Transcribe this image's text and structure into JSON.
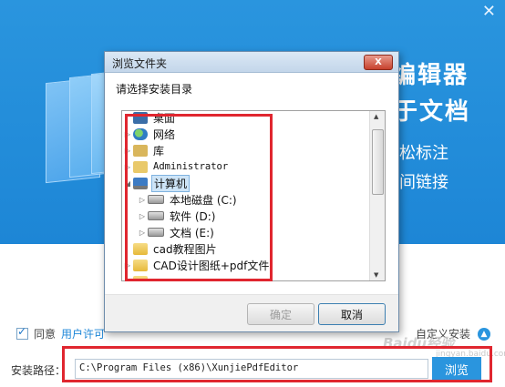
{
  "banner": {
    "close_glyph": "✕",
    "title_line1": "编辑器",
    "title_line2": "于文档",
    "feature1": "松标注",
    "feature2": "间链接",
    "doc_glyph": "d"
  },
  "dialog": {
    "title": "浏览文件夹",
    "close_glyph": "X",
    "prompt": "请选择安装目录",
    "tree": [
      {
        "label": "桌面",
        "icon": "desktop-icon",
        "arrow": ""
      },
      {
        "label": "网络",
        "icon": "network-icon",
        "arrow": "▷"
      },
      {
        "label": "库",
        "icon": "library-icon",
        "arrow": "▷"
      },
      {
        "label": "Administrator",
        "icon": "user-folder-icon",
        "arrow": "▷"
      },
      {
        "label": "计算机",
        "icon": "computer-icon",
        "arrow": "◢"
      },
      {
        "label": "本地磁盘 (C:)",
        "icon": "drive-icon",
        "arrow": "▷"
      },
      {
        "label": "软件 (D:)",
        "icon": "drive-icon",
        "arrow": "▷"
      },
      {
        "label": "文档 (E:)",
        "icon": "drive-icon",
        "arrow": "▷"
      },
      {
        "label": "cad教程图片",
        "icon": "folder-icon",
        "arrow": ""
      },
      {
        "label": "CAD设计图纸+pdf文件",
        "icon": "folder-icon",
        "arrow": "▷"
      }
    ],
    "ok_label": "确定",
    "cancel_label": "取消"
  },
  "install": {
    "agree_text": "同意",
    "license_link": "用户许可",
    "custom_install": "自定义安装",
    "path_label": "安装路径：",
    "path_value": "C:\\Program Files (x86)\\XunjiePdfEditor",
    "browse_label": "浏览"
  },
  "watermark": {
    "main": "Baidu经验",
    "sub": "jingyan.baidu.com"
  },
  "colors": {
    "accent": "#2a95de",
    "highlight_box": "#e0262f"
  }
}
